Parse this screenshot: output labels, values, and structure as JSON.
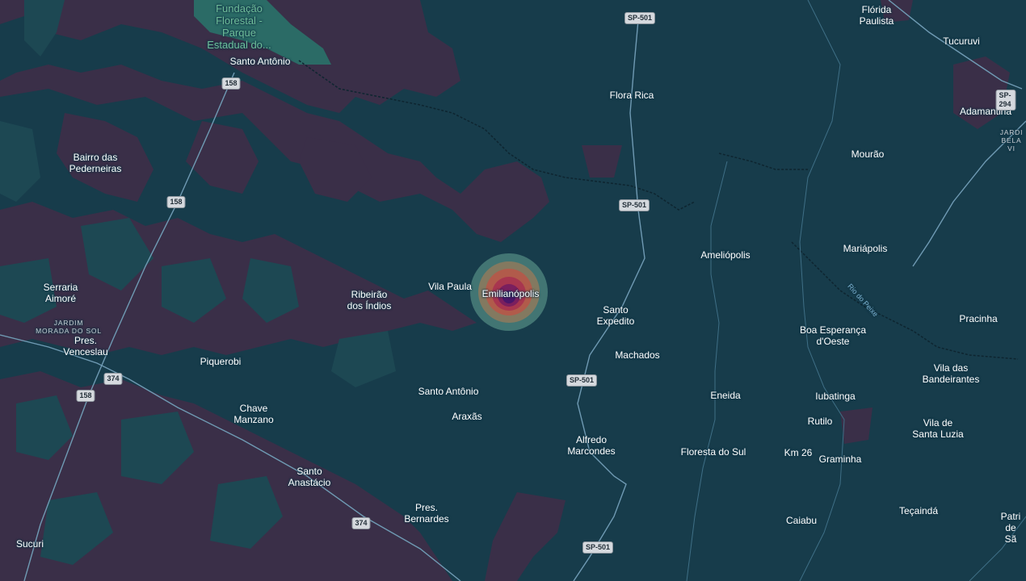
{
  "map": {
    "labels": {
      "fundacao": "Fundação\nFlorestal -\nParque\nEstadual do...",
      "santo_antonio_n": "Santo Antônio",
      "florida_paulista": "Flórida\nPaulista",
      "tucuruvi": "Tucuruvi",
      "flora_rica": "Flora Rica",
      "adamantina": "Adamantina",
      "jardim_bela_vista": "JARDI\nBELA VI",
      "bairro_pederneiras": "Bairro das\nPederneiras",
      "mourao": "Mourão",
      "ameliopolis": "Ameliópolis",
      "mariapolis": "Mariápolis",
      "rio_do_peixe": "Rio do Peixe",
      "serraria_aimore": "Serraria\nAimoré",
      "ribeirao_dos_indios": "Ribeirão\ndos Índios",
      "vila_paula": "Vila Paula",
      "emilianopolis": "Emilianópolis",
      "santo_expedito": "Santo\nExpedito",
      "pracinha": "Pracinha",
      "jardim_morada_do_sol": "JARDIM\nMORADA DO SOL",
      "pres_venceslau": "Pres.\nVenceslau",
      "boa_esperanca": "Boa Esperança\nd'Oeste",
      "machados": "Machados",
      "vila_das_bandeirantes": "Vila das\nBandeirantes",
      "piquerobi": "Piquerobi",
      "santo_antonio_s": "Santo Antônio",
      "eneida": "Eneida",
      "iubatinga": "Iubatinga",
      "chave_manzano": "Chave\nManzano",
      "araxas": "Araxãs",
      "rutilo": "Rutilo",
      "vila_de_santa_luzia": "Vila de\nSanta Luzia",
      "alfredo_marcondes": "Alfredo\nMarcondes",
      "floresta_do_sul": "Floresta do Sul",
      "km_26": "Km 26",
      "graminha": "Graminha",
      "santo_anastacio": "Santo\nAnastácio",
      "pres_bernardes": "Pres.\nBernardes",
      "tecainda": "Teçaindá",
      "caiabu": "Caiabu",
      "patri_de_sao": "Patri\nde Sã",
      "sucuri": "Sucuri"
    },
    "shields": {
      "sp501_a": "SP-501",
      "sp501_b": "SP-501",
      "sp501_c": "SP-501",
      "sp501_d": "SP-501",
      "sp294": "SP-294",
      "r158_a": "158",
      "r158_b": "158",
      "r158_c": "158",
      "r374_a": "374",
      "r374_b": "374"
    },
    "heatmap_center": "emilianopolis",
    "heatmap_colors": [
      "#4a7f7a",
      "#8b7a5e",
      "#b35a4a",
      "#a8364f",
      "#7a1f5e",
      "#4a1668"
    ],
    "colors": {
      "water": "#163a4a",
      "land_dark": "#3a2e48",
      "land_teal": "#1d4a55",
      "road": "#6f9ab3",
      "park": "#2b6b66"
    }
  }
}
